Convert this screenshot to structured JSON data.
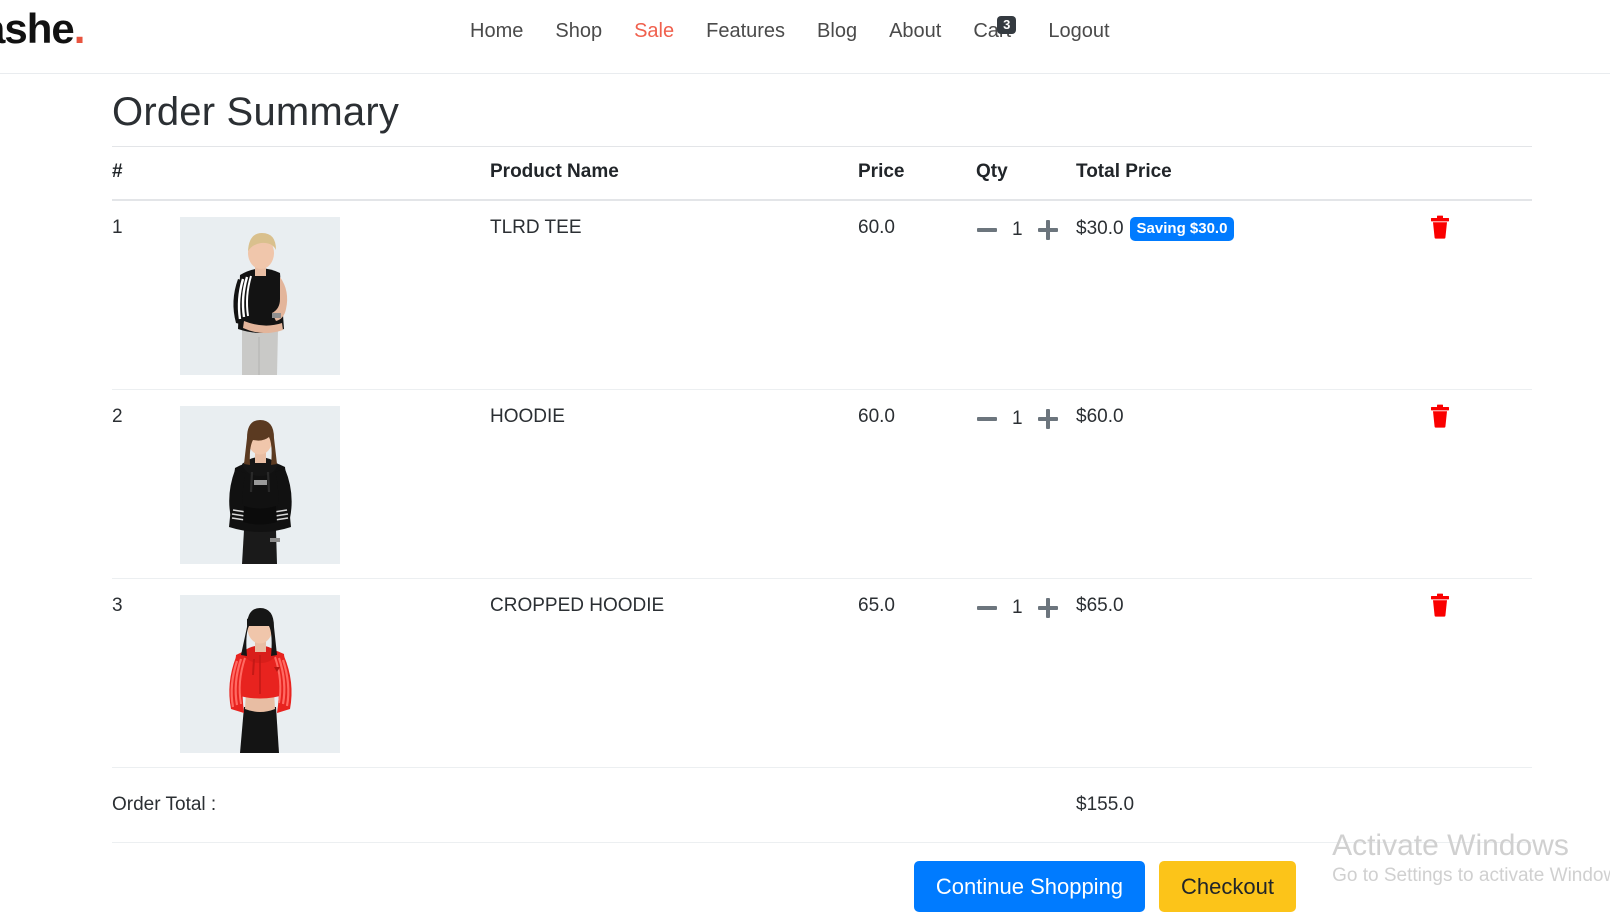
{
  "brand": {
    "text": "ashe",
    "dot": "."
  },
  "nav": {
    "items": [
      {
        "label": "Home",
        "active": false
      },
      {
        "label": "Shop",
        "active": false
      },
      {
        "label": "Sale",
        "active": true
      },
      {
        "label": "Features",
        "active": false
      },
      {
        "label": "Blog",
        "active": false
      },
      {
        "label": "About",
        "active": false
      }
    ],
    "cart": {
      "label": "Cart",
      "badge": "3"
    },
    "logout": {
      "label": "Logout"
    },
    "active_color": "#f0604d"
  },
  "page": {
    "title": "Order Summary"
  },
  "table": {
    "headers": {
      "index": "#",
      "product_name": "Product Name",
      "price": "Price",
      "qty": "Qty",
      "total_price": "Total Price"
    },
    "rows": [
      {
        "index": "1",
        "name": "TLRD TEE",
        "price": "60.0",
        "qty": "1",
        "total": "$30.0",
        "saving_badge": "Saving $30.0",
        "image_alt": "model wearing black tee with white stripes",
        "minus_icon": "minus-icon",
        "plus_icon": "plus-icon",
        "delete_icon": "trash-icon"
      },
      {
        "index": "2",
        "name": "HOODIE",
        "price": "60.0",
        "qty": "1",
        "total": "$60.0",
        "saving_badge": "",
        "image_alt": "model wearing black hoodie",
        "minus_icon": "minus-icon",
        "plus_icon": "plus-icon",
        "delete_icon": "trash-icon"
      },
      {
        "index": "3",
        "name": "CROPPED HOODIE",
        "price": "65.0",
        "qty": "1",
        "total": "$65.0",
        "saving_badge": "",
        "image_alt": "model wearing red cropped hoodie",
        "minus_icon": "minus-icon",
        "plus_icon": "plus-icon",
        "delete_icon": "trash-icon"
      }
    ],
    "order_total_label": "Order Total :",
    "order_total_value": "$155.0"
  },
  "actions": {
    "continue_shopping": "Continue Shopping",
    "checkout": "Checkout"
  },
  "colors": {
    "accent_red": "#f0604d",
    "badge_blue": "#007bff",
    "checkout_yellow": "#fcc419",
    "trash_red": "#fa0000",
    "cart_badge_dark": "#343a40"
  },
  "watermark": {
    "title": "Activate Windows",
    "subtitle": "Go to Settings to activate Windows."
  }
}
